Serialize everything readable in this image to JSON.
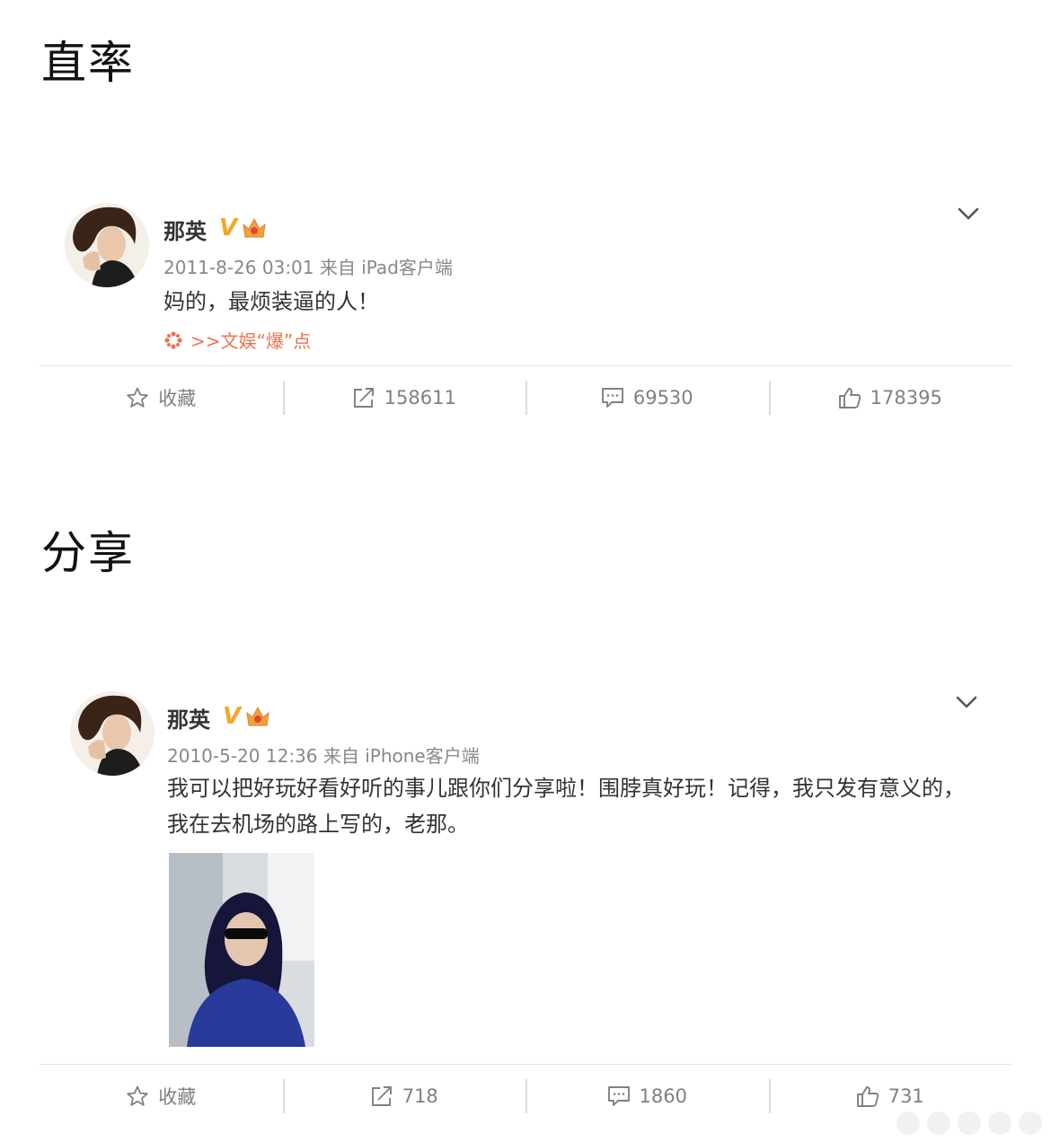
{
  "sections": [
    {
      "title": "直率",
      "post": {
        "username": "那英",
        "meta": "2011-8-26 03:01 来自 iPad客户端",
        "content": "妈的，最烦装逼的人！",
        "topic": ">>文娱“爆”点",
        "actions": {
          "favorite": "收藏",
          "repost": "158611",
          "comment": "69530",
          "like": "178395"
        }
      }
    },
    {
      "title": "分享",
      "post": {
        "username": "那英",
        "meta": "2010-5-20 12:36 来自 iPhone客户端",
        "content": "我可以把好玩好看好听的事儿跟你们分享啦！围脖真好玩！记得，我只发有意义的，我在去机场的路上写的，老那。",
        "actions": {
          "favorite": "收藏",
          "repost": "718",
          "comment": "1860",
          "like": "731"
        }
      }
    }
  ],
  "colors": {
    "text": "#333333",
    "meta": "#888888",
    "topic": "#eb7350",
    "vip": "#f5a623",
    "divider": "#e6e6e6"
  },
  "icons": [
    "star-icon",
    "repost-icon",
    "comment-icon",
    "like-icon",
    "chevron-down-icon",
    "vip-v-icon",
    "crown-badge-icon",
    "topic-flower-icon"
  ]
}
